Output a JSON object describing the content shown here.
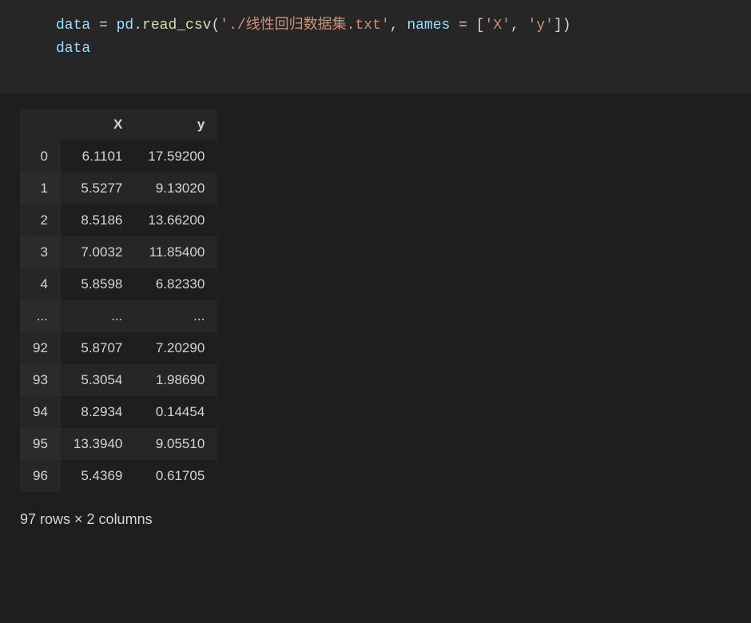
{
  "code": {
    "tokens_line1": [
      {
        "cls": "var",
        "text": "data"
      },
      {
        "cls": "op",
        "text": " = "
      },
      {
        "cls": "var",
        "text": "pd"
      },
      {
        "cls": "punc",
        "text": "."
      },
      {
        "cls": "func",
        "text": "read_csv"
      },
      {
        "cls": "punc",
        "text": "("
      },
      {
        "cls": "str",
        "text": "'./线性回归数据集.txt'"
      },
      {
        "cls": "punc",
        "text": ", "
      },
      {
        "cls": "var",
        "text": "names"
      },
      {
        "cls": "op",
        "text": " = "
      },
      {
        "cls": "punc",
        "text": "["
      },
      {
        "cls": "str",
        "text": "'X'"
      },
      {
        "cls": "punc",
        "text": ", "
      },
      {
        "cls": "str",
        "text": "'y'"
      },
      {
        "cls": "punc",
        "text": "])"
      }
    ],
    "tokens_line2": [
      {
        "cls": "var",
        "text": "data"
      }
    ]
  },
  "dataframe": {
    "columns": [
      "X",
      "y"
    ],
    "rows": [
      {
        "index": "0",
        "X": "6.1101",
        "y": "17.59200"
      },
      {
        "index": "1",
        "X": "5.5277",
        "y": "9.13020"
      },
      {
        "index": "2",
        "X": "8.5186",
        "y": "13.66200"
      },
      {
        "index": "3",
        "X": "7.0032",
        "y": "11.85400"
      },
      {
        "index": "4",
        "X": "5.8598",
        "y": "6.82330"
      },
      {
        "index": "...",
        "X": "...",
        "y": "..."
      },
      {
        "index": "92",
        "X": "5.8707",
        "y": "7.20290"
      },
      {
        "index": "93",
        "X": "5.3054",
        "y": "1.98690"
      },
      {
        "index": "94",
        "X": "8.2934",
        "y": "0.14454"
      },
      {
        "index": "95",
        "X": "13.3940",
        "y": "9.05510"
      },
      {
        "index": "96",
        "X": "5.4369",
        "y": "0.61705"
      }
    ],
    "summary": "97 rows × 2 columns"
  }
}
